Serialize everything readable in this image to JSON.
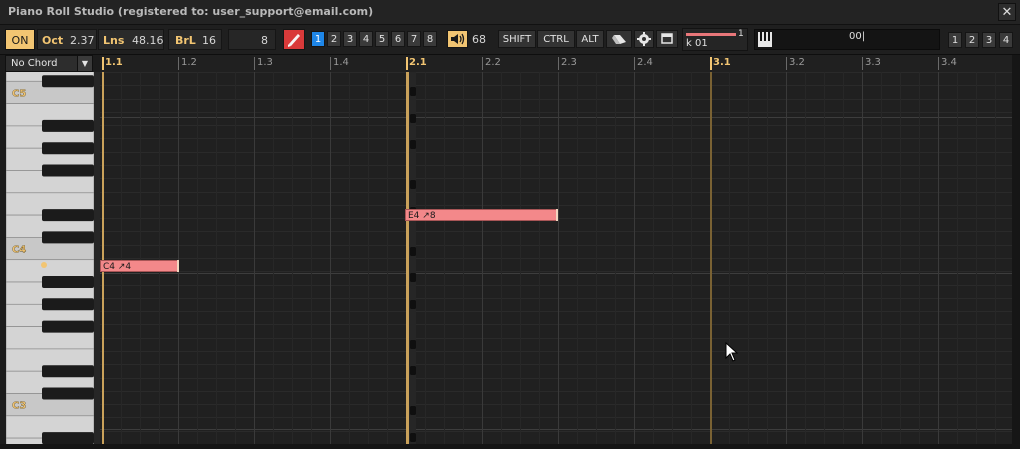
{
  "window": {
    "title": "Piano Roll Studio  (registered to: user_support@email.com)",
    "close_glyph": "✕"
  },
  "toolbar": {
    "on_label": "ON",
    "oct_label": "Oct",
    "oct_value": "2.37",
    "lns_label": "Lns",
    "lns_value": "48.16",
    "brl_label": "BrL",
    "brl_value": "16",
    "quant_value": "8",
    "pencil_icon": "pencil-icon",
    "channels": [
      "1",
      "2",
      "3",
      "4",
      "5",
      "6",
      "7",
      "8"
    ],
    "selected_channel": "1",
    "volume_value": "68",
    "modifiers": [
      "SHIFT",
      "CTRL",
      "ALT"
    ],
    "track_label": "k 01",
    "track_number": "1",
    "keyboard_value": "00|",
    "slots": [
      "1",
      "2",
      "3",
      "4"
    ],
    "accent": "#f2c572",
    "active_blue": "#1e86e8",
    "pencil_red": "#d93a3a"
  },
  "chord_select": {
    "value": "No Chord"
  },
  "ruler": {
    "labels": [
      "1.1",
      "1.2",
      "1.3",
      "1.4",
      "2.1",
      "2.2",
      "2.3",
      "2.4",
      "3.1",
      "3.2",
      "3.3",
      "3.4"
    ]
  },
  "keys": {
    "labels": [
      "C5",
      "C4",
      "C3"
    ]
  },
  "notes": [
    {
      "label": "C4 ↗4",
      "color": "#f3888a"
    },
    {
      "label": "E4 ↗8",
      "color": "#f3888a"
    }
  ]
}
